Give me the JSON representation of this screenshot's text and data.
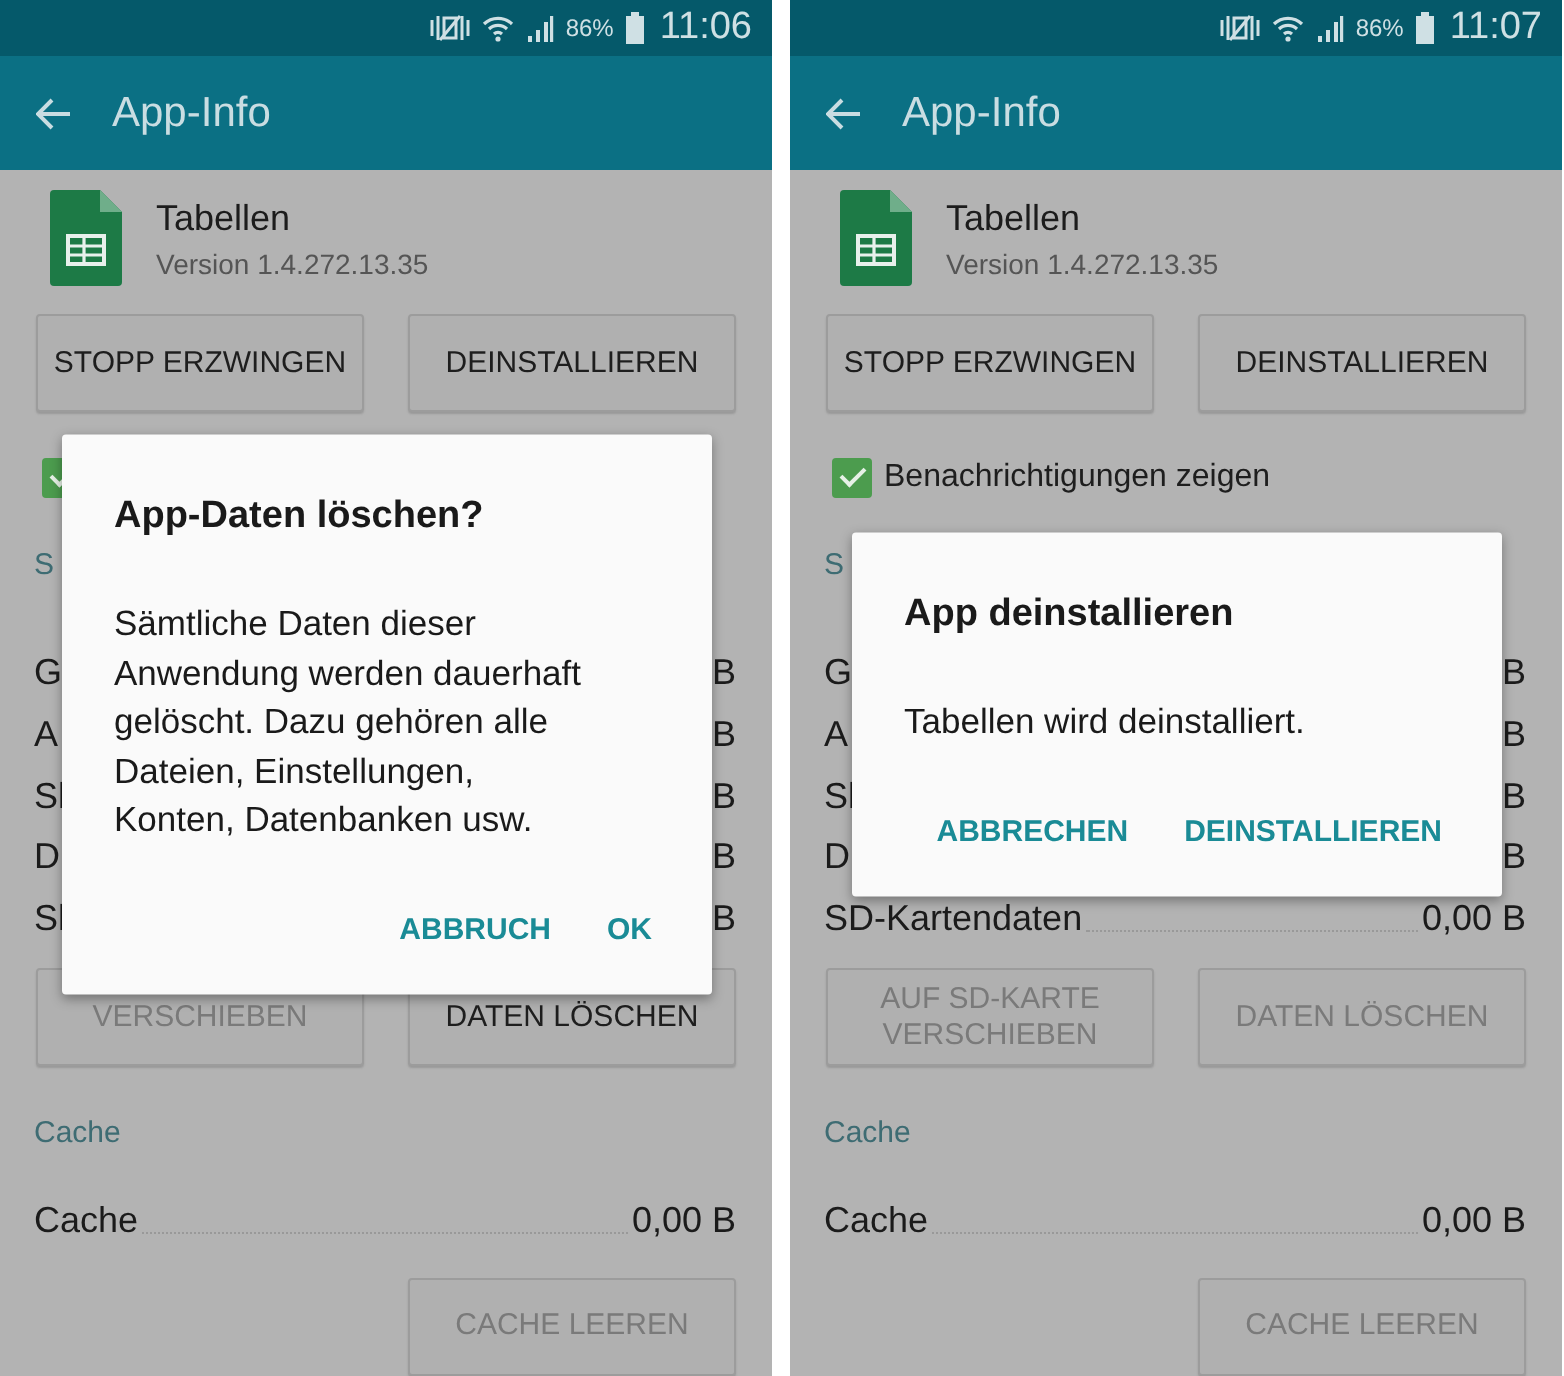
{
  "phones": [
    {
      "status": {
        "battery": "86%",
        "time": "11:06"
      },
      "appbar": {
        "title": "App-Info"
      },
      "app": {
        "name": "Tabellen",
        "version": "Version 1.4.272.13.35"
      },
      "top_buttons": [
        {
          "label": "STOPP ERZWINGEN",
          "disabled": false
        },
        {
          "label": "DEINSTALLIEREN",
          "disabled": false
        }
      ],
      "notification": {
        "checked": true
      },
      "storage_header": "S",
      "storage_rows": [
        {
          "label": "G",
          "value": "B"
        },
        {
          "label": "A",
          "value": "B"
        },
        {
          "label": "Sl",
          "value": "B"
        },
        {
          "label": "D",
          "value": "B"
        },
        {
          "label": "Sl",
          "value": "B"
        }
      ],
      "storage_buttons": [
        {
          "label": "VERSCHIEBEN",
          "disabled": true
        },
        {
          "label": "DATEN LÖSCHEN",
          "disabled": false
        }
      ],
      "cache_header": "Cache",
      "cache_row": {
        "label": "Cache",
        "value": "0,00 B"
      },
      "cache_button": {
        "label": "CACHE LEEREN",
        "disabled": true
      },
      "dialog": {
        "title": "App-Daten löschen?",
        "message": "Sämtliche Daten dieser Anwendung werden dauerhaft gelöscht. Dazu gehören alle Dateien, Einstellungen, Konten, Datenbanken usw.",
        "actions": [
          "ABBRUCH",
          "OK"
        ]
      }
    },
    {
      "status": {
        "battery": "86%",
        "time": "11:07"
      },
      "appbar": {
        "title": "App-Info"
      },
      "app": {
        "name": "Tabellen",
        "version": "Version 1.4.272.13.35"
      },
      "top_buttons": [
        {
          "label": "STOPP ERZWINGEN",
          "disabled": false
        },
        {
          "label": "DEINSTALLIEREN",
          "disabled": false
        }
      ],
      "notification": {
        "checked": true,
        "label": "Benachrichtigungen zeigen"
      },
      "storage_header": "S",
      "storage_rows": [
        {
          "label": "G",
          "value": "B"
        },
        {
          "label": "A",
          "value": "B"
        },
        {
          "label": "Sl",
          "value": "B"
        },
        {
          "label": "D",
          "value": "B"
        },
        {
          "label": "SD-Kartendaten",
          "value": "0,00 B"
        }
      ],
      "storage_buttons": [
        {
          "label": "AUF SD-KARTE VERSCHIEBEN",
          "disabled": true
        },
        {
          "label": "DATEN LÖSCHEN",
          "disabled": true
        }
      ],
      "cache_header": "Cache",
      "cache_row": {
        "label": "Cache",
        "value": "0,00 B"
      },
      "cache_button": {
        "label": "CACHE LEEREN",
        "disabled": true
      },
      "dialog": {
        "title": "App deinstallieren",
        "message": "Tabellen wird deinstalliert.",
        "actions": [
          "ABBRECHEN",
          "DEINSTALLIEREN"
        ]
      }
    }
  ]
}
